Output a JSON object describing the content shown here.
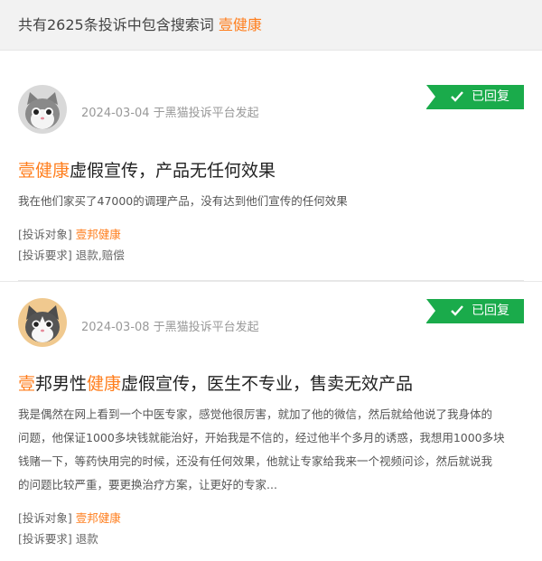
{
  "header": {
    "prefix": "共有2625条投诉中包含搜索词",
    "keyword": "壹健康"
  },
  "colors": {
    "accent": "#ff7e1d",
    "badge": "#1aab4b"
  },
  "complaints": [
    {
      "avatar_icon": "gray-cat-avatar",
      "meta": "2024-03-04 于黑猫投诉平台发起",
      "status": "已回复",
      "title_hl": "壹健康",
      "title_rest": "虚假宣传，产品无任何效果",
      "desc": "我在他们家买了47000的调理产品，没有达到他们宣传的任何效果",
      "target_label": "[投诉对象]",
      "target_a": "壹邦",
      "target_b": "健康",
      "request_label": "[投诉要求]",
      "request_value": "退款,赔偿"
    },
    {
      "avatar_icon": "tan-cat-avatar",
      "meta": "2024-03-08 于黑猫投诉平台发起",
      "status": "已回复",
      "title_p1": "壹",
      "title_p2": "邦男性",
      "title_p3": "健康",
      "title_p4": "虚假宣传，医生不专业，售卖无效产品",
      "desc_lines": [
        "我是偶然在网上看到一个中医专家，感觉他很厉害，就加了他的微信，然后就给他说了我身体的",
        "问题，他保证1000多块钱就能治好，开始我是不信的，经过他半个多月的诱惑，我想用1000多块",
        "钱赌一下，等药快用完的时候，还没有任何效果，他就让专家给我来一个视频问诊，然后就说我",
        "的问题比较严重，要更换治疗方案，让更好的专家..."
      ],
      "target_label": "[投诉对象]",
      "target_a": "壹邦",
      "target_b": "健康",
      "request_label": "[投诉要求]",
      "request_value": "退款"
    }
  ]
}
